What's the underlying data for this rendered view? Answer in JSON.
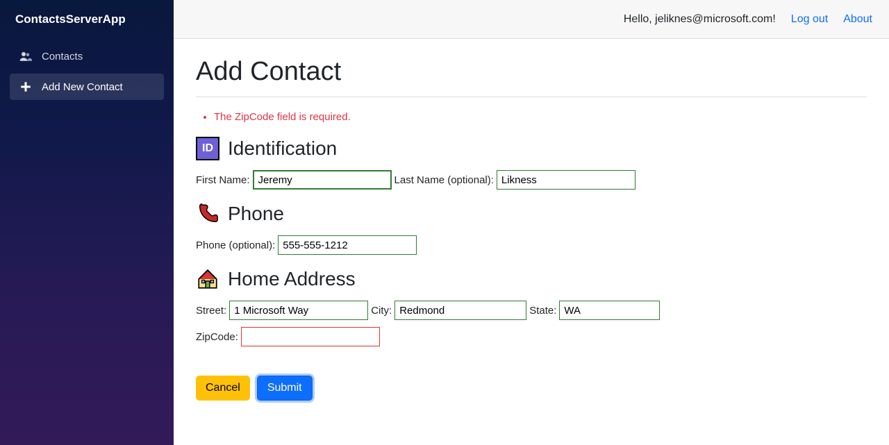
{
  "brand": "ContactsServerApp",
  "sidebar": {
    "items": [
      {
        "label": "Contacts"
      },
      {
        "label": "Add New Contact"
      }
    ]
  },
  "topbar": {
    "greeting": "Hello, jeliknes@microsoft.com!",
    "logout": "Log out",
    "about": "About"
  },
  "page": {
    "title": "Add Contact",
    "errors": [
      "The ZipCode field is required."
    ],
    "sections": {
      "identification": {
        "badge_text": "ID",
        "heading": "Identification",
        "first_name_label": "First Name:",
        "first_name_value": "Jeremy",
        "last_name_label": "Last Name (optional):",
        "last_name_value": "Likness"
      },
      "phone": {
        "heading": "Phone",
        "phone_label": "Phone (optional):",
        "phone_value": "555-555-1212"
      },
      "address": {
        "heading": "Home Address",
        "street_label": "Street:",
        "street_value": "1 Microsoft Way",
        "city_label": "City:",
        "city_value": "Redmond",
        "state_label": "State:",
        "state_value": "WA",
        "zip_label": "ZipCode:",
        "zip_value": ""
      }
    },
    "buttons": {
      "cancel": "Cancel",
      "submit": "Submit"
    }
  }
}
